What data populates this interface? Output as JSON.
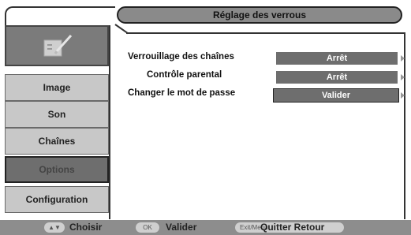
{
  "header": {
    "title": "Réglage des verrous"
  },
  "sidebar": {
    "logo_icon": "notepad-pencil-icon",
    "items": [
      {
        "label": "Image",
        "active": false
      },
      {
        "label": "Son",
        "active": false
      },
      {
        "label": "Chaînes",
        "active": false
      },
      {
        "label": "Options",
        "active": true
      },
      {
        "label": "Configuration",
        "active": false
      }
    ]
  },
  "settings": [
    {
      "label": "Verrouillage des chaînes",
      "value": "Arrêt"
    },
    {
      "label": "Contrôle parental",
      "value": "Arrêt"
    },
    {
      "label": "Changer le mot de passe",
      "value": "Valider",
      "selected": true
    }
  ],
  "footer": {
    "choose_key": "▲▼",
    "choose_label": "Choisir",
    "ok_key": "OK",
    "ok_label": "Valider",
    "exit_key": "Exit/Menu",
    "exit_label": "Quitter Retour"
  }
}
